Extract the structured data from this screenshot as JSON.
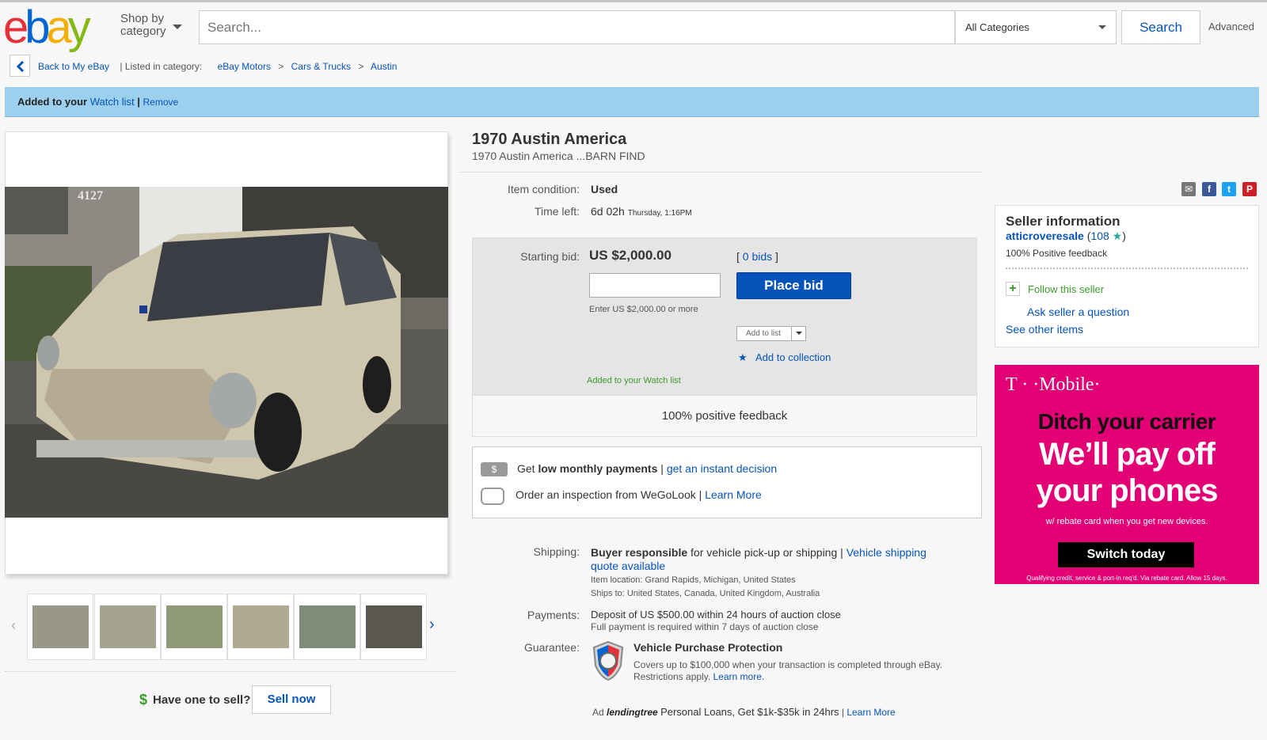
{
  "header": {
    "logo_text": "ebay",
    "shop_by_line1": "Shop by",
    "shop_by_line2": "category",
    "search_placeholder": "Search...",
    "category_selected": "All Categories",
    "search_button": "Search",
    "advanced": "Advanced"
  },
  "breadcrumb": {
    "back": "Back to My eBay",
    "listed_in": "|  Listed in category:",
    "items": [
      "eBay Motors",
      ">",
      "Cars & Trucks",
      ">",
      "Austin"
    ]
  },
  "watch_bar": {
    "prefix": "Added to your",
    "watch_link": "Watch list",
    "pipe": "|",
    "remove": "Remove"
  },
  "item": {
    "title": "1970 Austin America",
    "subtitle": "1970 Austin America ...BARN FIND",
    "condition_label": "Item condition:",
    "condition_value": "Used",
    "time_left_label": "Time left:",
    "time_left_value": "6d 02h",
    "time_left_detail": "Thursday, 1:16PM"
  },
  "bid": {
    "starting_label": "Starting bid:",
    "starting_value": "US $2,000.00",
    "bids_open": "[",
    "bids_link": "0 bids",
    "bids_close": "]",
    "input_value": "",
    "place_bid": "Place bid",
    "enter_note": "Enter US $2,000.00 or more",
    "add_to_list": "Add to list",
    "add_to_collection": "Add to collection",
    "added_note": "Added to your Watch list",
    "feedback_footer": "100% positive feedback"
  },
  "payments_box": {
    "row1_prefix": "Get",
    "row1_bold": "low monthly payments",
    "row1_pipe": "|",
    "row1_link": "get an instant decision",
    "row2_text": "Order an inspection from WeGoLook",
    "row2_pipe": "|",
    "row2_link": "Learn More"
  },
  "shipping": {
    "label": "Shipping:",
    "bold": "Buyer responsible",
    "text": "for vehicle pick-up or shipping",
    "pipe": "|",
    "link_line1": "Vehicle shipping",
    "link_line2": "quote available",
    "location": "Item location:  Grand Rapids, Michigan, United States",
    "ships_to": "Ships to:  United States, Canada, United Kingdom, Australia"
  },
  "payments": {
    "label": "Payments:",
    "line1": "Deposit of US $500.00 within 24 hours of auction close",
    "line2": "Full payment is required within 7 days of auction close"
  },
  "guarantee": {
    "label": "Guarantee:",
    "title": "Vehicle Purchase Protection",
    "line1": "Covers up to $100,000 when your transaction is completed through eBay.",
    "line2": "Restrictions apply.",
    "link": "Learn more."
  },
  "bottom_ad": {
    "ad": "Ad",
    "brand": "lendingtree",
    "text": "Personal Loans, Get $1k-$35k in 24hrs",
    "pipe": "|",
    "link": "Learn More"
  },
  "seller": {
    "title": "Seller information",
    "name": "atticroveresale",
    "score_open": "(",
    "score": "108",
    "score_close": ")",
    "feedback": "100% Positive feedback",
    "follow": "Follow this seller",
    "ask": "Ask seller a question",
    "other": "See other items"
  },
  "ad": {
    "brand": "T · ·Mobile·",
    "headline1": "Ditch your carrier",
    "headline2a": "We’ll pay off",
    "headline2b": "your phones",
    "small": "w/ rebate card when you get new devices.",
    "button": "Switch today",
    "fine": "Qualifying credit, service & port-in req'd. Via rebate card. Allow 15 days."
  },
  "sell": {
    "dollar": "$",
    "label": "Have one to sell?",
    "button": "Sell now"
  },
  "photo": {
    "house_number": "4127"
  },
  "colors": {
    "ebay_blue": "#0654ba",
    "watch_bar": "#9dd0ee",
    "tmobile": "#e20074",
    "green": "#3a9b2b"
  }
}
